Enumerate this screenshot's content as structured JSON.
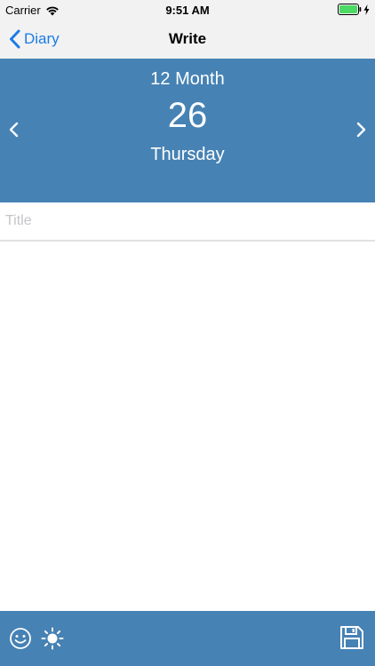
{
  "status_bar": {
    "carrier": "Carrier",
    "time": "9:51 AM"
  },
  "nav": {
    "back_label": "Diary",
    "title": "Write"
  },
  "date": {
    "month": "12 Month",
    "day": "26",
    "weekday": "Thursday"
  },
  "editor": {
    "title_placeholder": "Title",
    "title_value": "",
    "body_value": ""
  },
  "colors": {
    "accent": "#4682b4",
    "link": "#1a7ce6",
    "battery": "#4cd964"
  },
  "icons": {
    "emoji": "smiley-icon",
    "weather": "sun-icon",
    "save": "floppy-disk-icon"
  }
}
